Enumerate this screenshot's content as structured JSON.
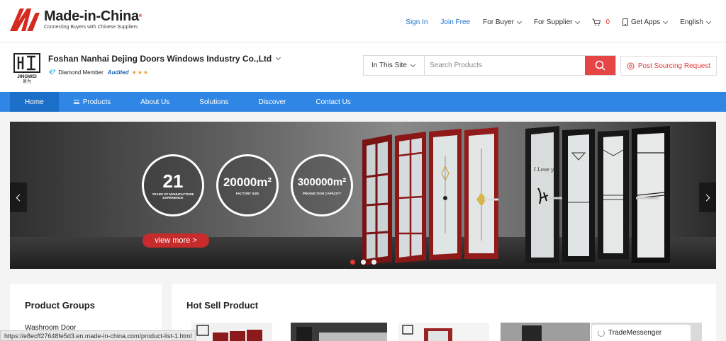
{
  "header": {
    "brand": "Made-in-China",
    "brand_mark": "®",
    "tagline": "Connecting Buyers with Chinese Suppliers",
    "nav": {
      "sign_in": "Sign In",
      "join_free": "Join Free",
      "for_buyer": "For Buyer",
      "for_supplier": "For Supplier",
      "cart_count": "0",
      "get_apps": "Get Apps",
      "language": "English"
    }
  },
  "company": {
    "logo_text": "JINGWEI",
    "logo_sub": "景为",
    "name": "Foshan Nanhai Dejing Doors Windows Industry Co.,Ltd",
    "membership": "Diamond Member",
    "audited": "Audited",
    "stars": "★★★"
  },
  "search": {
    "scope": "In This Site",
    "placeholder": "Search Products"
  },
  "post_sourcing": "Post Sourcing Request",
  "main_nav": [
    {
      "label": "Home",
      "active": true
    },
    {
      "label": "Products",
      "active": false
    },
    {
      "label": "About Us",
      "active": false
    },
    {
      "label": "Solutions",
      "active": false
    },
    {
      "label": "Discover",
      "active": false
    },
    {
      "label": "Contact Us",
      "active": false
    }
  ],
  "banner": {
    "stats": [
      {
        "value": "21",
        "label": "YEARS OF MANUFACTURE EXPERIENCE"
      },
      {
        "value": "20000m²",
        "label": "FACTORY SIZE"
      },
      {
        "value": "300000m²",
        "label": "PRODUCTION CAPACITY"
      }
    ],
    "cta": "view more >",
    "door_text": "I Love you",
    "slides_total": 3,
    "slide_active": 1
  },
  "product_groups": {
    "title": "Product Groups",
    "items": [
      "Washroom Door"
    ]
  },
  "hot_sell": {
    "title": "Hot Sell Product"
  },
  "status_url": "https://e8ecff27648fe5d3.en.made-in-china.com/product-list-1.html",
  "trade_messenger": "TradeMessenger",
  "colors": {
    "brand_red": "#e53935",
    "nav_blue": "#2f86e4",
    "link_blue": "#1a6fc9"
  }
}
